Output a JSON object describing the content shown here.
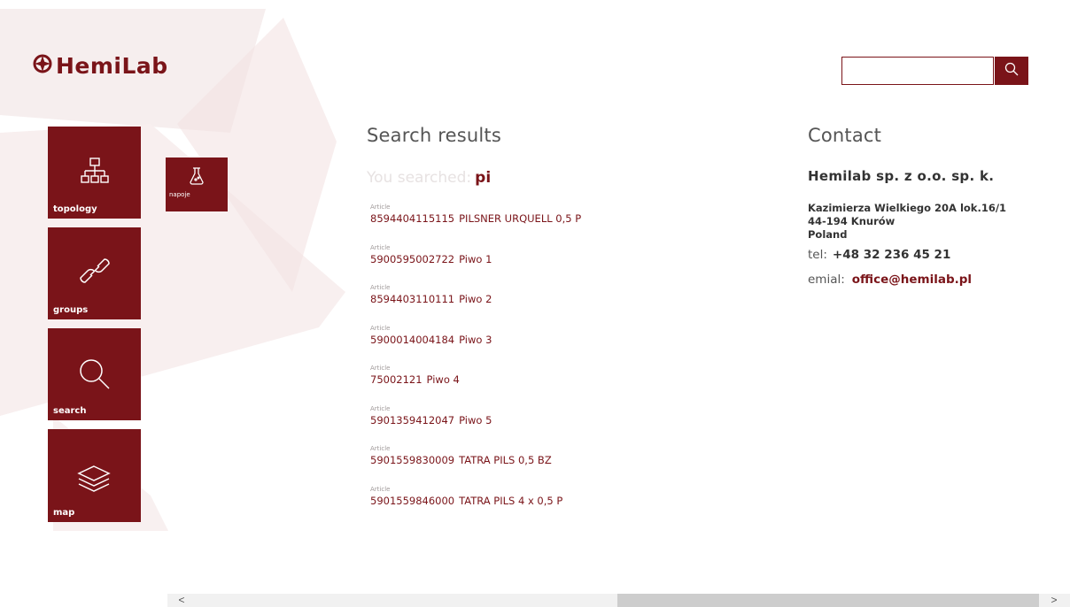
{
  "brand": {
    "logo_text": "HemiLab",
    "accent": "#7a1419"
  },
  "search": {
    "value": "",
    "placeholder": "",
    "button_icon": "search-icon"
  },
  "nav_tiles": [
    {
      "label": "topology",
      "icon": "topology-icon"
    },
    {
      "label": "groups",
      "icon": "link-icon"
    },
    {
      "label": "search",
      "icon": "search-icon"
    },
    {
      "label": "map",
      "icon": "layers-icon"
    }
  ],
  "group_tile": {
    "label": "napoje",
    "icon": "flask-icon"
  },
  "results": {
    "title": "Search results",
    "searched_label": "You searched:",
    "searched_term": "pi",
    "items": [
      {
        "type": "Article",
        "code": "8594404115115",
        "name": "PILSNER URQUELL 0,5 P"
      },
      {
        "type": "Article",
        "code": "5900595002722",
        "name": "Piwo 1"
      },
      {
        "type": "Article",
        "code": "8594403110111",
        "name": "Piwo 2"
      },
      {
        "type": "Article",
        "code": "5900014004184",
        "name": "Piwo 3"
      },
      {
        "type": "Article",
        "code": "75002121",
        "name": "Piwo 4"
      },
      {
        "type": "Article",
        "code": "5901359412047",
        "name": "Piwo 5"
      },
      {
        "type": "Article",
        "code": "5901559830009",
        "name": "TATRA PILS 0,5 BZ"
      },
      {
        "type": "Article",
        "code": "5901559846000",
        "name": "TATRA PILS 4 x 0,5 P"
      }
    ]
  },
  "contact": {
    "title": "Contact",
    "company": "Hemilab sp. z o.o. sp. k.",
    "address_line1": "Kazimierza Wielkiego 20A lok.16/1",
    "address_line2": "44-194 Knurów",
    "address_line3": "Poland",
    "tel_label": "tel:",
    "tel_value": "+48 32 236 45 21",
    "email_label": "emial:",
    "email_value": "office@hemilab.pl"
  },
  "scrollbar": {
    "left_arrow": "<",
    "right_arrow": ">"
  }
}
